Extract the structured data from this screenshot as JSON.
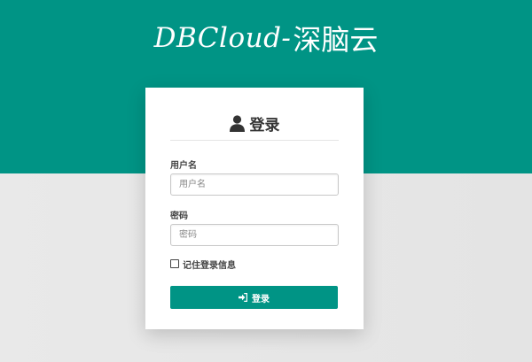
{
  "brand": {
    "latin": "DBCloud-",
    "chinese": "深脑云"
  },
  "login": {
    "title": "登录",
    "username": {
      "label": "用户名",
      "placeholder": "用户名",
      "value": ""
    },
    "password": {
      "label": "密码",
      "placeholder": "密码",
      "value": ""
    },
    "remember_label": "记住登录信息",
    "remember_checked": false,
    "submit_label": "登录"
  },
  "colors": {
    "accent": "#009485",
    "background": "#e6e6e6",
    "card": "#ffffff"
  },
  "icons": {
    "title_icon": "user-icon",
    "button_icon": "sign-in-icon"
  }
}
